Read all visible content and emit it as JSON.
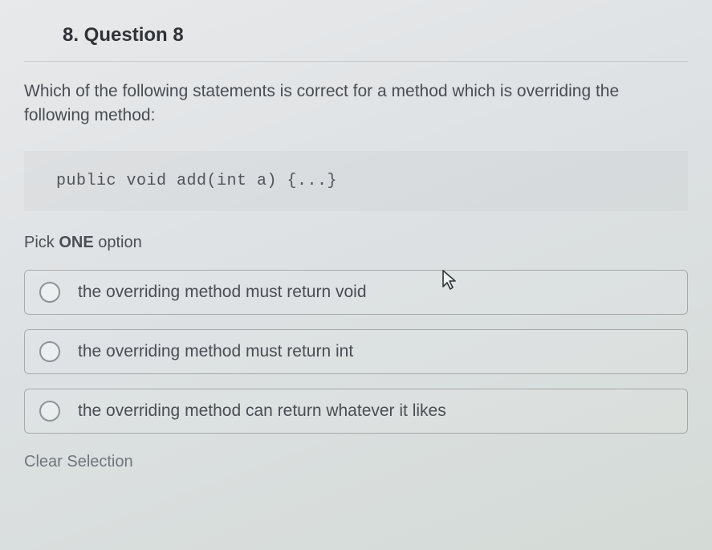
{
  "question": {
    "number_label": "8. Question 8",
    "prompt": "Which of the following statements is correct for a method which is overriding the following method:",
    "code": "public void add(int a) {...}",
    "pick_prefix": "Pick ",
    "pick_bold": "ONE",
    "pick_suffix": " option"
  },
  "options": [
    {
      "label": "the overriding method must return void"
    },
    {
      "label": "the overriding method must return int"
    },
    {
      "label": "the overriding method can return whatever it likes"
    }
  ],
  "actions": {
    "clear_selection": "Clear Selection"
  }
}
